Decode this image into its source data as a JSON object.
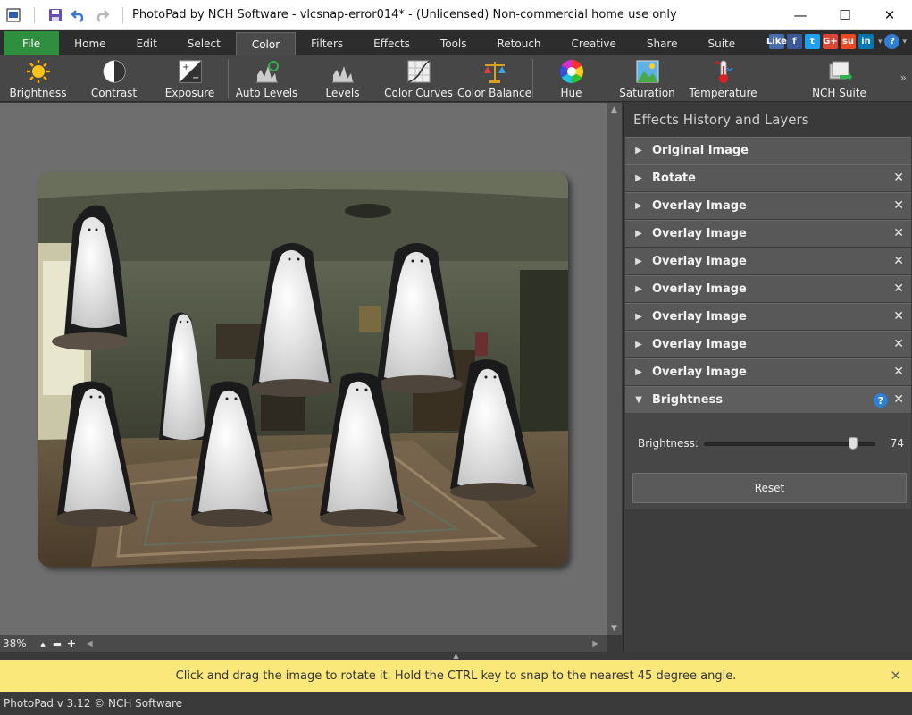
{
  "window": {
    "title": "PhotoPad by NCH Software - vlcsnap-error014* - (Unlicensed) Non-commercial home use only",
    "controls": [
      "—",
      "☐",
      "✕"
    ]
  },
  "menu": {
    "tabs": [
      "File",
      "Home",
      "Edit",
      "Select",
      "Color",
      "Filters",
      "Effects",
      "Tools",
      "Retouch",
      "Creative",
      "Share",
      "Suite"
    ],
    "active": "Color",
    "social": [
      "Like",
      "f",
      "t",
      "G+",
      "su",
      "in"
    ]
  },
  "toolbar": {
    "tools": [
      {
        "label": "Brightness",
        "icon": "sun-icon"
      },
      {
        "label": "Contrast",
        "icon": "contrast-icon"
      },
      {
        "label": "Exposure",
        "icon": "exposure-icon"
      },
      {
        "label": "Auto Levels",
        "icon": "auto-levels-icon"
      },
      {
        "label": "Levels",
        "icon": "levels-icon"
      },
      {
        "label": "Color Curves",
        "icon": "color-curves-icon"
      },
      {
        "label": "Color Balance",
        "icon": "color-balance-icon"
      },
      {
        "label": "Hue",
        "icon": "hue-wheel-icon"
      },
      {
        "label": "Saturation",
        "icon": "saturation-icon"
      },
      {
        "label": "Temperature",
        "icon": "thermometer-icon"
      },
      {
        "label": "NCH Suite",
        "icon": "nch-suite-icon"
      }
    ],
    "more": "»"
  },
  "canvas": {
    "zoom": "38%"
  },
  "panel": {
    "title": "Effects History and Layers",
    "layers": [
      {
        "label": "Original Image",
        "closable": false
      },
      {
        "label": "Rotate",
        "closable": true
      },
      {
        "label": "Overlay Image",
        "closable": true
      },
      {
        "label": "Overlay Image",
        "closable": true
      },
      {
        "label": "Overlay Image",
        "closable": true
      },
      {
        "label": "Overlay Image",
        "closable": true
      },
      {
        "label": "Overlay Image",
        "closable": true
      },
      {
        "label": "Overlay Image",
        "closable": true
      },
      {
        "label": "Overlay Image",
        "closable": true
      }
    ],
    "brightness": {
      "label": "Brightness",
      "slider_label": "Brightness:",
      "value": "74",
      "fraction": 0.87,
      "reset_label": "Reset"
    }
  },
  "hint": {
    "text": "Click and drag the image to rotate it. Hold the CTRL key to snap to the nearest 45 degree angle."
  },
  "status": {
    "text": "PhotoPad v 3.12 © NCH Software"
  },
  "colors": {
    "file_tab": "#2f8f3f",
    "accent_blue": "#2f7fd6",
    "hint_bg": "#fbe87a"
  }
}
